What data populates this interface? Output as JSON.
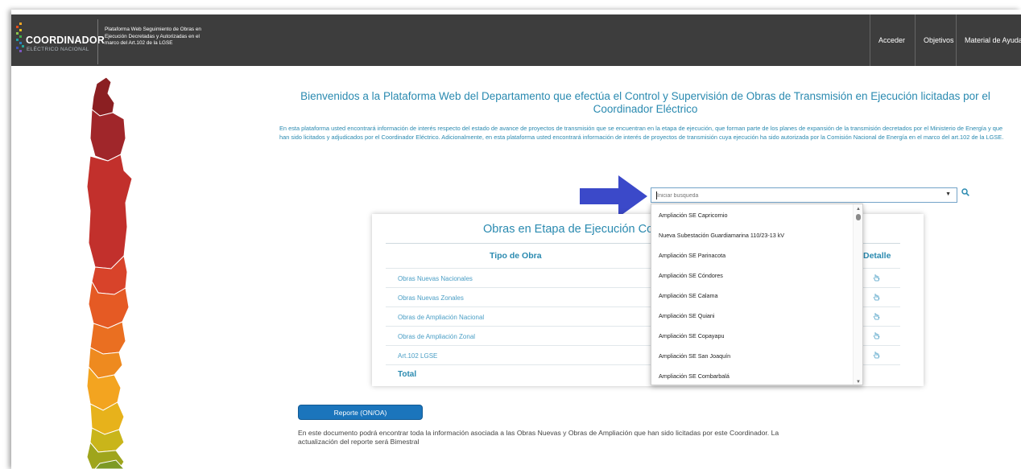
{
  "header": {
    "logo_title": "COORDINADOR",
    "logo_subtitle": "ELÉCTRICO NACIONAL",
    "platform_title": "Plataforma Web Seguimiento de Obras en Ejecución Decretadas y Autorizadas en el marco del Art.102 de la LGSE",
    "nav": [
      "Acceder",
      "Objetivos",
      "Material de Ayuda"
    ],
    "bg_color": "#3d3d3d"
  },
  "welcome": {
    "title": "Bienvenidos a la Plataforma Web del Departamento que efectúa el Control y Supervisión de Obras de Transmisión en Ejecución licitadas por el Coordinador Eléctrico",
    "text": "En esta plataforma usted encontrará información de interés respecto del estado de avance de proyectos de transmisión que se encuentran en la etapa de ejecución, que forman parte de los planes de expansión de la transmisión decretados por el Ministerio de Energía y que han sido licitados y adjudicados por el Coordinador Eléctrico. Adicionalmente, en esta plataforma usted encontrará información de interés de proyectos de transmisión cuya ejecución ha sido autorizada por la Comisión Nacional de Energía en el marco del art.102 de la LGSE."
  },
  "search": {
    "placeholder": "Iniciar busqueda",
    "options": [
      "Ampliación SE Capricornio",
      "Nueva Subestación Guardiamarina 110/23-13 kV",
      "Ampliación SE Parinacota",
      "Ampliación SE Cóndores",
      "Ampliación SE Calama",
      "Ampliación SE Quiani",
      "Ampliación SE Copayapu",
      "Ampliación SE San Joaquín",
      "Ampliación SE Combarbalá"
    ]
  },
  "table": {
    "title": "Obras en Etapa de Ejecución Co",
    "col_tipo": "Tipo de Obra",
    "col_detalle": "Detalle",
    "rows": [
      "Obras Nuevas Nacionales",
      "Obras Nuevas Zonales",
      "Obras de Ampliación Nacional",
      "Obras de Ampliación Zonal",
      "Art.102 LGSE"
    ],
    "total_label": "Total"
  },
  "report": {
    "button_label": "Reporte (ON/OA)",
    "text": "En este documento podrá encontrar toda la información asociada a las Obras Nuevas y Obras de Ampliación que han sido licitadas por este Coordinador. La actualización del reporte será Bimestral"
  },
  "colors": {
    "accent": "#2a8ab0",
    "button": "#1b75bc",
    "arrow": "#3b49c9"
  }
}
